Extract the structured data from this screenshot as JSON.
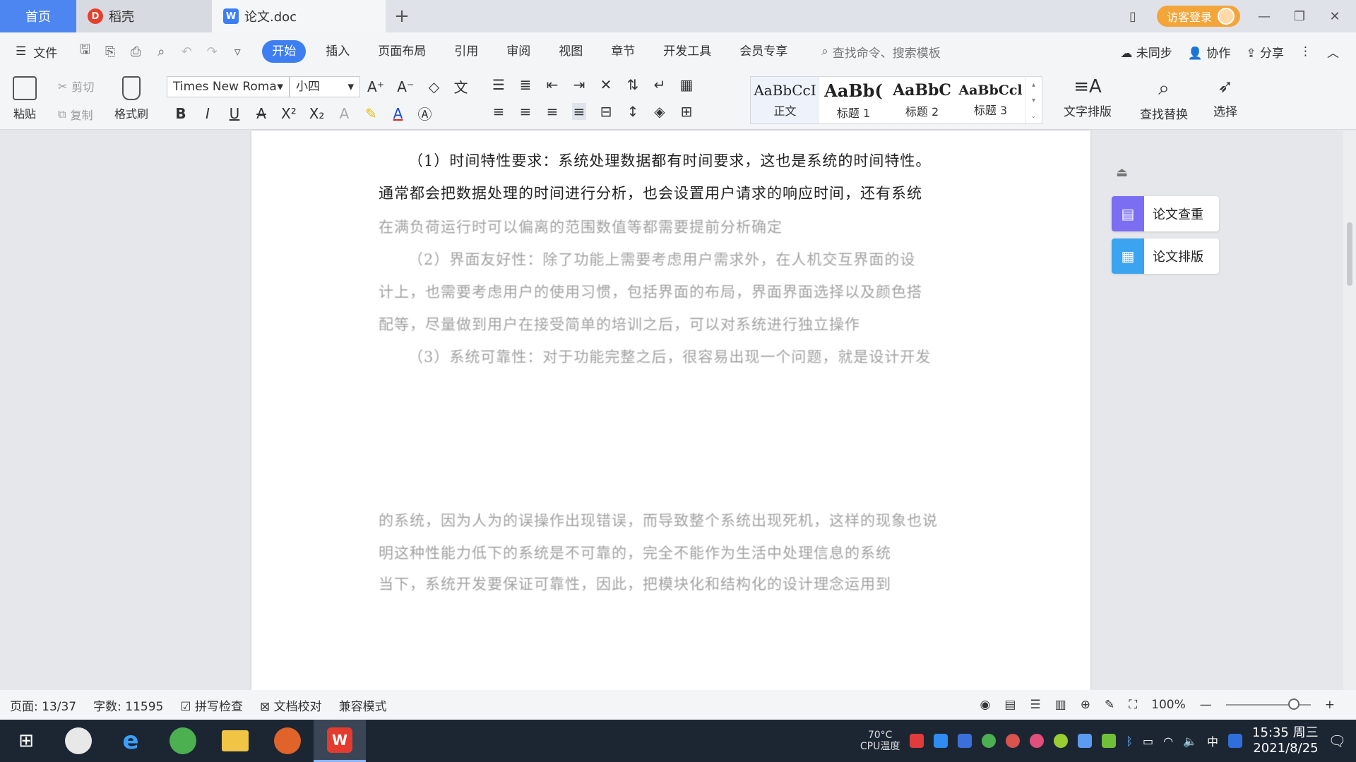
{
  "tabs": {
    "home": "首页",
    "daoke": "稻壳",
    "doc": "论文.doc"
  },
  "title_right": {
    "login": "访客登录"
  },
  "menu": {
    "file": "文件",
    "items": [
      "开始",
      "插入",
      "页面布局",
      "引用",
      "审阅",
      "视图",
      "章节",
      "开发工具",
      "会员专享"
    ],
    "search": "查找命令、搜索模板",
    "sync": "未同步",
    "collab": "协作",
    "share": "分享"
  },
  "ribbon": {
    "paste": "粘贴",
    "cut": "剪切",
    "copy": "复制",
    "format_painter": "格式刷",
    "font_name": "Times New Roma",
    "font_size": "小四",
    "styles": [
      {
        "preview": "AaBbCcI",
        "name": "正文"
      },
      {
        "preview": "AaBb(",
        "name": "标题 1"
      },
      {
        "preview": "AaBbC",
        "name": "标题 2"
      },
      {
        "preview": "AaBbCcl",
        "name": "标题 3"
      }
    ],
    "text_layout": "文字排版",
    "find_replace": "查找替换",
    "select": "选择"
  },
  "document": {
    "paragraphs": [
      {
        "text": "（1）时间特性要求：系统处理数据都有时间要求，这也是系统的时间特性。",
        "indent": true,
        "faded": false
      },
      {
        "text": "通常都会把数据处理的时间进行分析，也会设置用户请求的响应时间，还有系统",
        "indent": false,
        "faded": false
      },
      {
        "text": "在满负荷运行时可以偏离的范围数值等都需要提前分析确定",
        "indent": false,
        "faded": true
      },
      {
        "text": "（2）界面友好性：除了功能上需要考虑用户需求外，在人机交互界面的设",
        "indent": true,
        "faded": true
      },
      {
        "text": "计上，也需要考虑用户的使用习惯，包括界面的布局，界面界面选择以及颜色搭",
        "indent": false,
        "faded": true
      },
      {
        "text": "配等，尽量做到用户在接受简单的培训之后，可以对系统进行独立操作",
        "indent": false,
        "faded": true
      },
      {
        "text": "（3）系统可靠性：对于功能完整之后，很容易出现一个问题，就是设计开发",
        "indent": true,
        "faded": true
      },
      {
        "text": "的系统，因为人为的误操作出现错误，而导致整个系统出现死机，这样的现象也说",
        "indent": false,
        "faded": true
      },
      {
        "text": "明这种性能力低下的系统是不可靠的，完全不能作为生活中处理信息的系统",
        "indent": false,
        "faded": true
      },
      {
        "text": "当下，系统开发要保证可靠性，因此，把模块化和结构化的设计理念运用到",
        "indent": false,
        "faded": true
      }
    ]
  },
  "side_panel": {
    "check": "论文查重",
    "layout": "论文排版"
  },
  "status": {
    "page": "页面: 13/37",
    "words": "字数: 11595",
    "spell": "拼写检查",
    "proof": "文档校对",
    "compat": "兼容模式",
    "zoom": "100%",
    "zoom_level": 0.8
  },
  "taskbar": {
    "cpu_temp": "70°C",
    "cpu_label": "CPU温度",
    "ime": "中",
    "time": "15:35 周三",
    "date": "2021/8/25"
  },
  "colors": {
    "accent": "#3d7ef2",
    "home_tab": "#4d86f0",
    "login": "#f3a53a",
    "check_icon": "#7b6ef2",
    "layout_icon": "#3ba3f0"
  }
}
